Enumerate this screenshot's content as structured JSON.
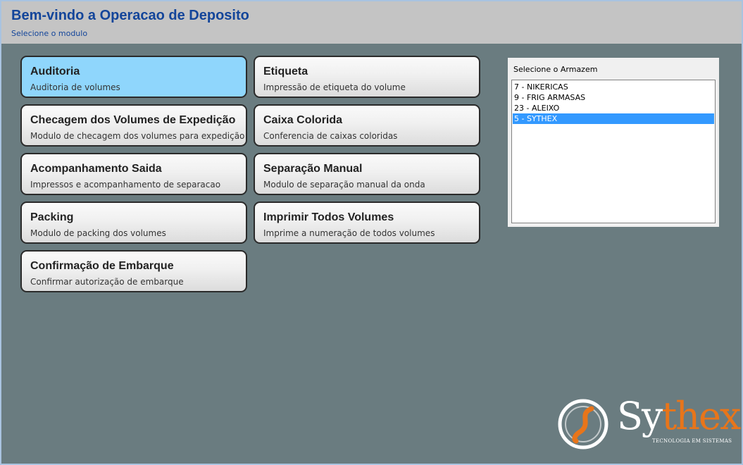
{
  "header": {
    "title": "Bem-vindo a Operacao de Deposito",
    "subtitle": "Selecione o modulo"
  },
  "modules": [
    {
      "title": "Auditoria",
      "description": "Auditoria de volumes",
      "active": true
    },
    {
      "title": "Etiqueta",
      "description": "Impressão de etiqueta do volume"
    },
    {
      "title": "Checagem dos Volumes de Expedição",
      "description": "Modulo de checagem dos volumes para expedição"
    },
    {
      "title": "Caixa Colorida",
      "description": "Conferencia de caixas coloridas"
    },
    {
      "title": "Acompanhamento Saida",
      "description": "Impressos e acompanhamento de separacao"
    },
    {
      "title": "Separação Manual",
      "description": "Modulo de separação manual da onda"
    },
    {
      "title": "Packing",
      "description": "Modulo de packing dos volumes"
    },
    {
      "title": "Imprimir Todos Volumes",
      "description": "Imprime a numeração de todos volumes"
    },
    {
      "title": "Confirmação de Embarque",
      "description": "Confirmar autorização de embarque"
    }
  ],
  "warehouse": {
    "label": "Selecione o Armazem",
    "items": [
      "7 - NIKERICAS",
      "9 - FRIG ARMASAS",
      "23 - ALEIXO",
      "5 - SYTHEX"
    ],
    "selected": "5 - SYTHEX"
  },
  "logo": {
    "brand_part1": "Sy",
    "brand_part2": "thex",
    "tagline": "TECNOLOGIA EM SISTEMAS",
    "icon": "swirl-s-logo-icon",
    "colors": {
      "accent": "#e8751a",
      "text": "#ffffff"
    }
  },
  "colors": {
    "background": "#6a7c80",
    "header_bg": "#c4c4c4",
    "title_blue": "#13459a",
    "active_tile": "#8fd6fc",
    "selection": "#3399ff"
  }
}
